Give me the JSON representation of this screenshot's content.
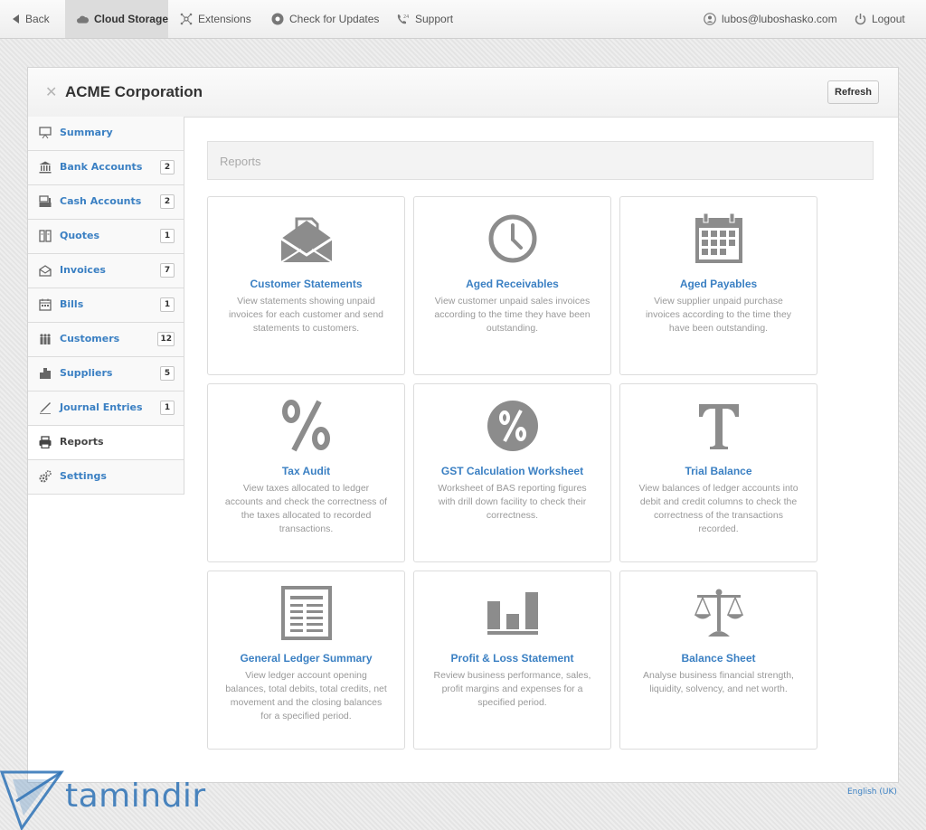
{
  "topbar": {
    "back": "Back",
    "cloud_storage": "Cloud Storage",
    "extensions": "Extensions",
    "check_updates": "Check for Updates",
    "support": "Support",
    "user": "lubos@luboshasko.com",
    "logout": "Logout"
  },
  "header": {
    "close": "✕",
    "company": "ACME Corporation",
    "refresh": "Refresh"
  },
  "sidebar": {
    "items": [
      {
        "label": "Summary",
        "icon": "presentation-icon",
        "count": ""
      },
      {
        "label": "Bank Accounts",
        "icon": "bank-icon",
        "count": "2"
      },
      {
        "label": "Cash Accounts",
        "icon": "cash-register-icon",
        "count": "2"
      },
      {
        "label": "Quotes",
        "icon": "quote-icon",
        "count": "1"
      },
      {
        "label": "Invoices",
        "icon": "invoice-icon",
        "count": "7"
      },
      {
        "label": "Bills",
        "icon": "bills-icon",
        "count": "1"
      },
      {
        "label": "Customers",
        "icon": "customers-icon",
        "count": "12"
      },
      {
        "label": "Suppliers",
        "icon": "suppliers-icon",
        "count": "5"
      },
      {
        "label": "Journal Entries",
        "icon": "pen-icon",
        "count": "1"
      },
      {
        "label": "Reports",
        "icon": "printer-icon",
        "count": ""
      },
      {
        "label": "Settings",
        "icon": "gears-icon",
        "count": ""
      }
    ],
    "active": "Reports"
  },
  "reports": {
    "heading": "Reports",
    "cards": [
      {
        "title": "Customer Statements",
        "icon": "envelope-icon",
        "desc": "View statements showing unpaid invoices for each customer and send statements to customers."
      },
      {
        "title": "Aged Receivables",
        "icon": "clock-icon",
        "desc": "View customer unpaid sales invoices according to the time they have been outstanding."
      },
      {
        "title": "Aged Payables",
        "icon": "calendar-icon",
        "desc": "View supplier unpaid purchase invoices according to the time they have been outstanding."
      },
      {
        "title": "Tax Audit",
        "icon": "percent-icon",
        "desc": "View taxes allocated to ledger accounts and check the correctness of the taxes allocated to recorded transactions."
      },
      {
        "title": "GST Calculation Worksheet",
        "icon": "percent-circle-icon",
        "desc": "Worksheet of BAS reporting figures with drill down facility to check their correctness."
      },
      {
        "title": "Trial Balance",
        "icon": "letter-t-icon",
        "desc": "View balances of ledger accounts into debit and credit columns to check the correctness of the transactions recorded."
      },
      {
        "title": "General Ledger Summary",
        "icon": "ledger-icon",
        "desc": "View ledger account opening balances, total debits, total credits, net movement and the closing balances for a specified period."
      },
      {
        "title": "Profit & Loss Statement",
        "icon": "bar-chart-icon",
        "desc": "Review business performance, sales, profit margins and expenses for a specified period."
      },
      {
        "title": "Balance Sheet",
        "icon": "scales-icon",
        "desc": "Analyse business financial strength, liquidity, solvency, and net worth."
      }
    ]
  },
  "footer": {
    "language": "English (UK)",
    "watermark": "tamindir"
  },
  "colors": {
    "link_blue": "#3b80c3",
    "icon_grey": "#8c8c8c",
    "watermark_blue": "#2d72b6"
  }
}
